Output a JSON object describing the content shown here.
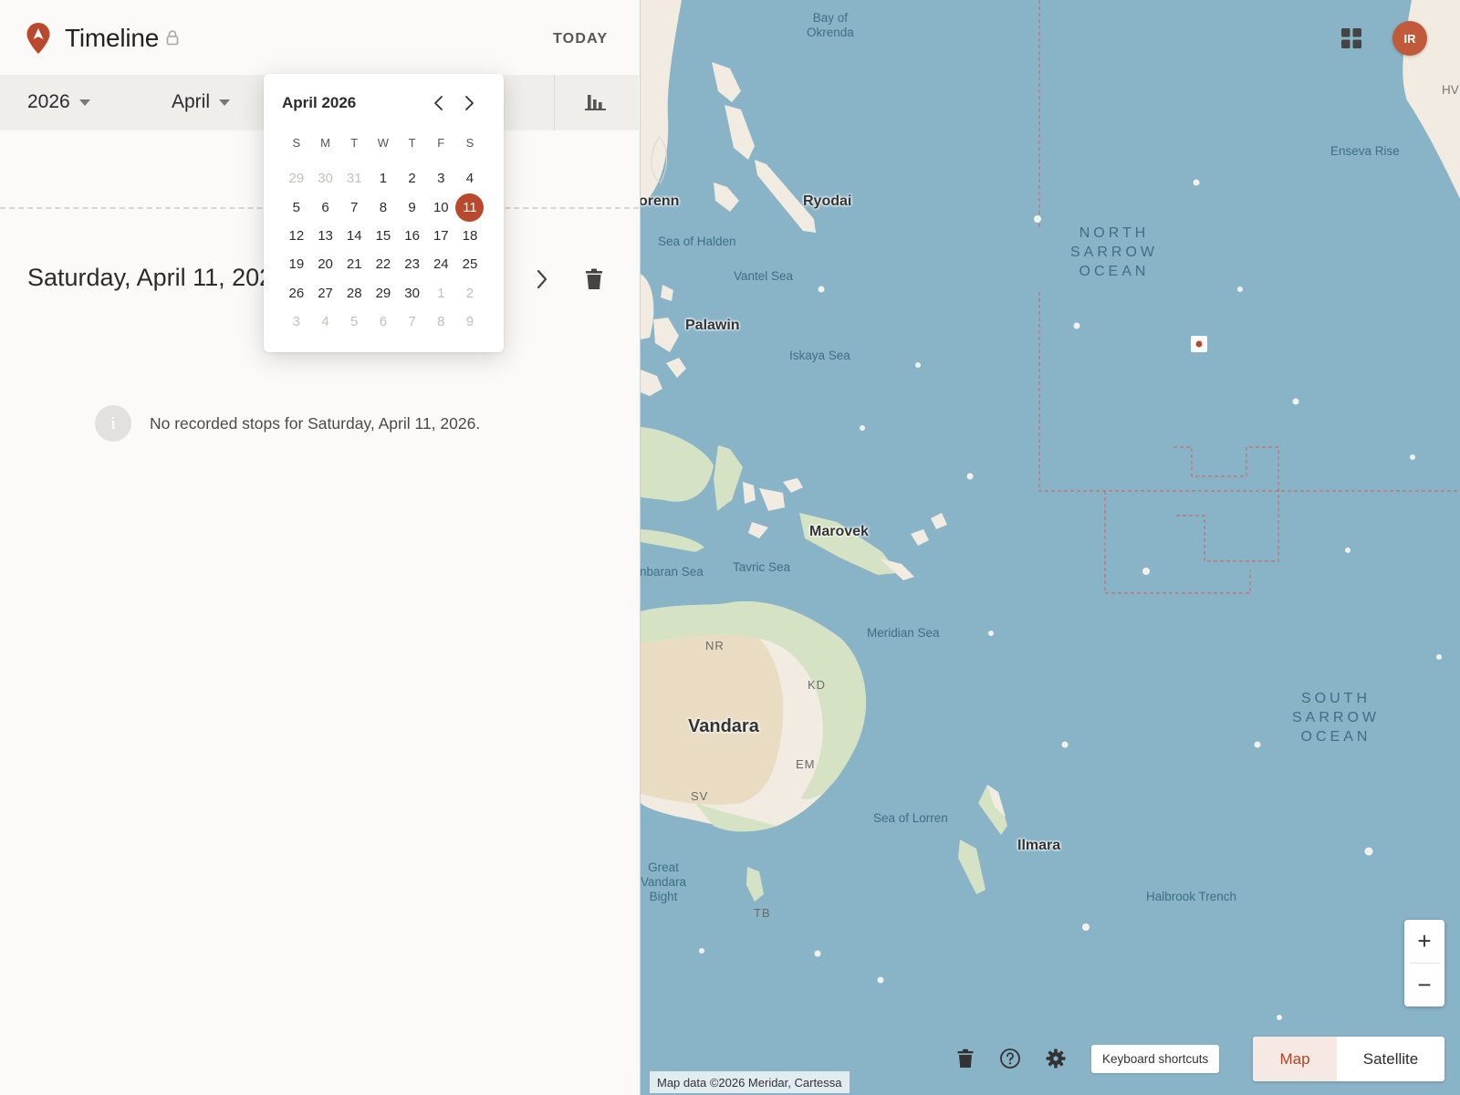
{
  "header": {
    "title": "Timeline",
    "today_label": "TODAY"
  },
  "filters": {
    "year": "2026",
    "month": "April"
  },
  "day": {
    "heading": "Saturday, April 11, 2026",
    "empty_message": "No recorded stops for Saturday, April 11, 2026.",
    "info_glyph": "i"
  },
  "calendar": {
    "title": "April 2026",
    "weekdays": [
      "S",
      "M",
      "T",
      "W",
      "T",
      "F",
      "S"
    ],
    "selected": "11",
    "leading_muted": [
      "29",
      "30",
      "31"
    ],
    "days": [
      "1",
      "2",
      "3",
      "4",
      "5",
      "6",
      "7",
      "8",
      "9",
      "10",
      "11",
      "12",
      "13",
      "14",
      "15",
      "16",
      "17",
      "18",
      "19",
      "20",
      "21",
      "22",
      "23",
      "24",
      "25",
      "26",
      "27",
      "28",
      "29",
      "30"
    ],
    "trailing_muted": [
      "1",
      "2",
      "3",
      "4",
      "5",
      "6",
      "7",
      "8",
      "9"
    ]
  },
  "map": {
    "labels": {
      "bay": "Bay of\nOkrenda",
      "okrenn": "orenn",
      "ryodai": "Ryodai",
      "sea_halden": "Sea of Halden",
      "vantel": "Vantel Sea",
      "palawin": "Palawin",
      "iskaya": "Iskaya Sea",
      "north_ocean": "NORTH\nSARROW\nOCEAN",
      "enseva": "Enseva Rise",
      "hv": "HV",
      "marovek": "Marovek",
      "nbaran": "nbaran Sea",
      "tavric": "Tavric Sea",
      "meridian": "Meridian Sea",
      "nr": "NR",
      "kd": "KD",
      "vandara": "Vandara",
      "em": "EM",
      "sv": "SV",
      "south_ocean": "SOUTH\nSARROW\nOCEAN",
      "lorren": "Sea of Lorren",
      "ilmara": "Ilmara",
      "bight": "Great\nVandara\nBight",
      "tb": "TB",
      "halbrook": "Halbrook Trench"
    },
    "user_initials": "IR",
    "zoom_in": "+",
    "zoom_out": "−",
    "keyboard_shortcuts": "Keyboard shortcuts",
    "type_map": "Map",
    "type_satellite": "Satellite",
    "attribution": "Map data ©2026 Meridar, Cartessa"
  },
  "icons": {
    "logo": "location-pin-icon",
    "lock": "lock-icon",
    "stats": "bar-chart-icon",
    "next": "chevron-right-icon",
    "delete": "trash-icon",
    "apps": "grid-icon",
    "help": "help-circle-icon",
    "settings": "gear-icon"
  },
  "colors": {
    "accent": "#b9482c",
    "water": "#89b3c7",
    "land": "#f1ebe1",
    "vegetation": "#d6e2c4",
    "desert": "#eadcc3"
  }
}
